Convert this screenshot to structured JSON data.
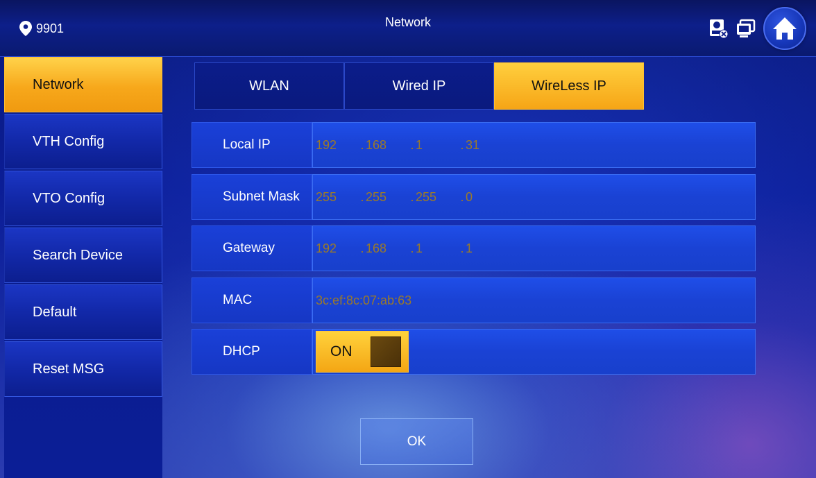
{
  "header": {
    "room_number": "9901",
    "title": "Network",
    "icons": [
      "location-pin-icon",
      "contact-card-icon",
      "message-monitor-icon",
      "home-icon"
    ]
  },
  "sidebar": {
    "items": [
      {
        "label": "Network",
        "active": true
      },
      {
        "label": "VTH Config",
        "active": false
      },
      {
        "label": "VTO Config",
        "active": false
      },
      {
        "label": "Search Device",
        "active": false
      },
      {
        "label": "Default",
        "active": false
      },
      {
        "label": "Reset MSG",
        "active": false
      }
    ]
  },
  "tabs": [
    {
      "label": "WLAN",
      "active": false
    },
    {
      "label": "Wired IP",
      "active": false
    },
    {
      "label": "WireLess IP",
      "active": true
    }
  ],
  "form": {
    "local_ip": {
      "label": "Local IP",
      "segments": [
        "192",
        "168",
        "1",
        "31"
      ]
    },
    "subnet_mask": {
      "label": "Subnet Mask",
      "segments": [
        "255",
        "255",
        "255",
        "0"
      ]
    },
    "gateway": {
      "label": "Gateway",
      "segments": [
        "192",
        "168",
        "1",
        "1"
      ]
    },
    "mac": {
      "label": "MAC",
      "value": "3c:ef:8c:07:ab:63"
    },
    "dhcp": {
      "label": "DHCP",
      "state": "ON"
    }
  },
  "ok_label": "OK",
  "colors": {
    "accent_active": "#f6a516",
    "background": "#0b1d96",
    "value_text": "#9a7a2a"
  }
}
